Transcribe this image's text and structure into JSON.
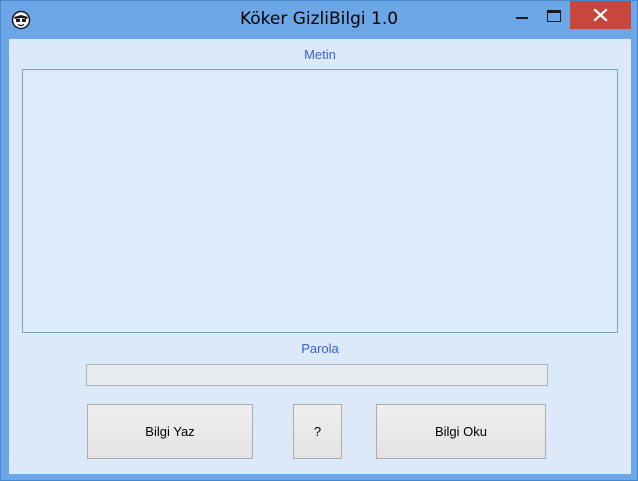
{
  "window": {
    "title": "Köker GizliBilgi 1.0",
    "app_icon": "face-icon",
    "controls": {
      "minimize_icon": "minimize-icon",
      "maximize_icon": "maximize-icon",
      "close_icon": "close-icon"
    },
    "colors": {
      "frame": "#6ba6e6",
      "client": "#dbe9f9",
      "close_button": "#c9463c",
      "label_text": "#3a5fd0"
    }
  },
  "form": {
    "message_label": "Metin",
    "message_value": "",
    "password_label": "Parola",
    "password_value": ""
  },
  "buttons": {
    "write_label": "Bilgi Yaz",
    "help_label": "?",
    "read_label": "Bilgi Oku"
  }
}
